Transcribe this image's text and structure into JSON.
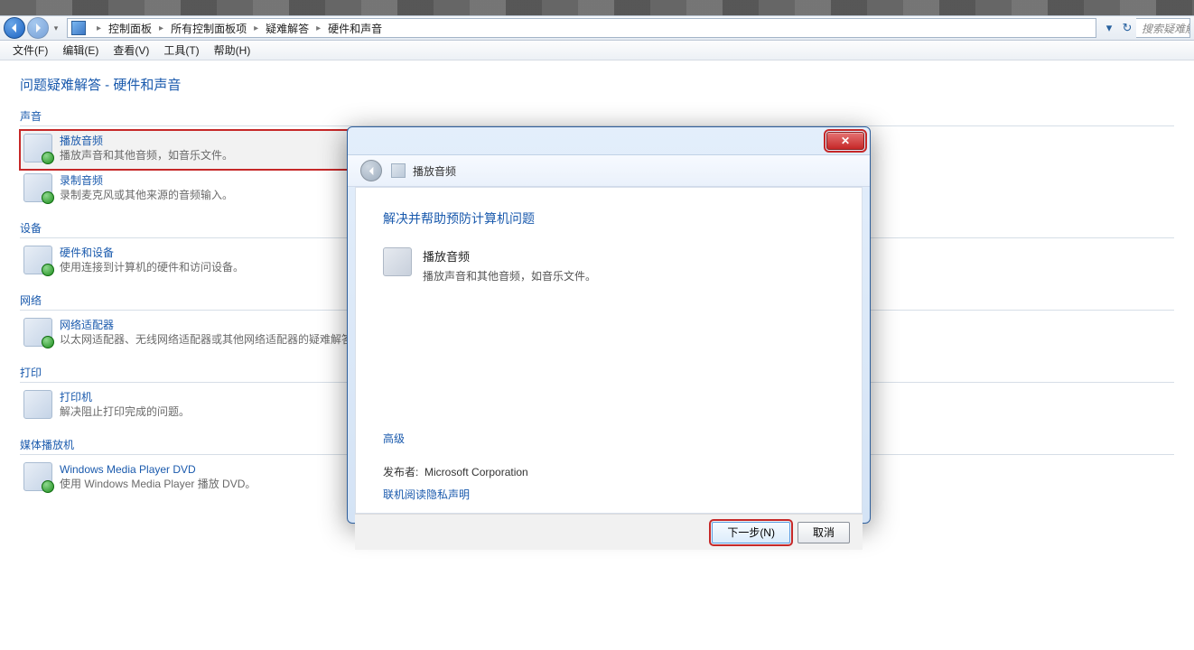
{
  "breadcrumb": {
    "p0": "控制面板",
    "p1": "所有控制面板项",
    "p2": "疑难解答",
    "p3": "硬件和声音"
  },
  "search": {
    "placeholder": "搜索疑难解答"
  },
  "menu": {
    "file": "文件(F)",
    "edit": "编辑(E)",
    "view": "查看(V)",
    "tools": "工具(T)",
    "help": "帮助(H)"
  },
  "page": {
    "title": "问题疑难解答 - 硬件和声音"
  },
  "sections": {
    "sound": {
      "header": "声音",
      "play": {
        "title": "播放音频",
        "desc": "播放声音和其他音频，如音乐文件。"
      },
      "record": {
        "title": "录制音频",
        "desc": "录制麦克风或其他来源的音频输入。"
      }
    },
    "device": {
      "header": "设备",
      "hw": {
        "title": "硬件和设备",
        "desc": "使用连接到计算机的硬件和访问设备。"
      }
    },
    "network": {
      "header": "网络",
      "adapter": {
        "title": "网络适配器",
        "desc": "以太网适配器、无线网络适配器或其他网络适配器的疑难解答。"
      }
    },
    "print": {
      "header": "打印",
      "printer": {
        "title": "打印机",
        "desc": "解决阻止打印完成的问题。"
      }
    },
    "media": {
      "header": "媒体播放机",
      "wmp": {
        "title": "Windows Media Player DVD",
        "desc": "使用 Windows Media Player 播放 DVD。"
      }
    }
  },
  "dialog": {
    "title": "播放音频",
    "heading": "解决并帮助预防计算机问题",
    "item_title": "播放音频",
    "item_desc": "播放声音和其他音频，如音乐文件。",
    "advanced": "高级",
    "publisher_label": "发布者:",
    "publisher": "Microsoft Corporation",
    "privacy": "联机阅读隐私声明",
    "next": "下一步(N)",
    "cancel": "取消"
  }
}
